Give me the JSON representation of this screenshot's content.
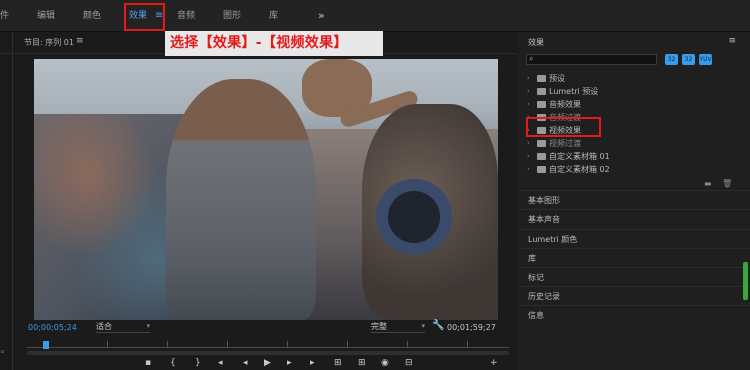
{
  "workspaces": {
    "items": [
      {
        "label": "件",
        "active": false
      },
      {
        "label": "编辑",
        "active": false
      },
      {
        "label": "颜色",
        "active": false
      },
      {
        "label": "效果",
        "active": true
      },
      {
        "label": "音频",
        "active": false
      },
      {
        "label": "图形",
        "active": false
      },
      {
        "label": "库",
        "active": false
      }
    ],
    "menu_glyph": "≡",
    "more_glyph": "»"
  },
  "callout": {
    "text": "选择【效果】-【视频效果】"
  },
  "program": {
    "title": "节目: 序列 01",
    "menu_glyph": "≡",
    "timecode_current": "00;00;05;24",
    "fit_label": "适合",
    "quality_label": "完整",
    "timecode_duration": "00;01;59;27"
  },
  "effects": {
    "title": "效果",
    "menu_glyph": "≡",
    "search": {
      "value": "",
      "placeholder": ""
    },
    "filter_buttons": [
      "32",
      "32",
      "YUV"
    ],
    "tree": [
      {
        "label": "预设",
        "dim": false
      },
      {
        "label": "Lumetri 预设",
        "dim": false
      },
      {
        "label": "音频效果",
        "dim": false
      },
      {
        "label": "音频过渡",
        "dim": true
      },
      {
        "label": "视频效果",
        "dim": false,
        "highlight": true
      },
      {
        "label": "视频过渡",
        "dim": true
      },
      {
        "label": "自定义素材箱 01",
        "dim": false
      },
      {
        "label": "自定义素材箱 02",
        "dim": false
      }
    ],
    "sections": [
      "基本图形",
      "基本声音",
      "Lumetri 颜色",
      "库",
      "标记",
      "历史记录",
      "信息"
    ]
  },
  "colors": {
    "accent": "#4da3f2",
    "highlight_red": "#e8191a",
    "scroll_green": "#3ca53c"
  }
}
